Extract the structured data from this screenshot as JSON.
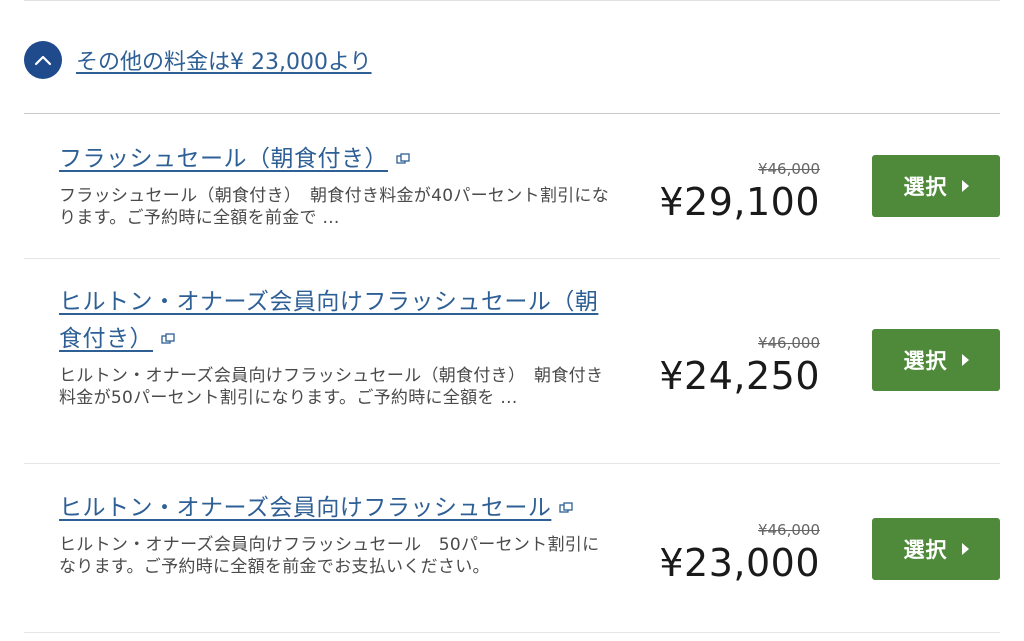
{
  "other_rates": {
    "toggle_label": "その他の料金は¥ 23,000より",
    "toggle_icon": "chevron-up-icon",
    "accent_color": "#1f4a8c"
  },
  "rates": [
    {
      "title": "フラッシュセール（朝食付き）",
      "description": "フラッシュセール（朝食付き）　朝食付き料金が40パーセント割引になります。ご予約時に全額を前金で ...",
      "original_price": "¥46,000",
      "price": "¥29,100",
      "button_label": "選択"
    },
    {
      "title": "ヒルトン・オナーズ会員向けフラッシュセール（朝食付き）",
      "description": "ヒルトン・オナーズ会員向けフラッシュセール（朝食付き）　朝食付き料金が50パーセント割引になります。ご予約時に全額を ...",
      "original_price": "¥46,000",
      "price": "¥24,250",
      "button_label": "選択"
    },
    {
      "title": "ヒルトン・オナーズ会員向けフラッシュセール",
      "description": "ヒルトン・オナーズ会員向けフラッシュセール　50パーセント割引になります。ご予約時に全額を前金でお支払いください。",
      "original_price": "¥46,000",
      "price": "¥23,000",
      "button_label": "選択"
    }
  ],
  "colors": {
    "link": "#2e5f95",
    "button": "#4e8a3a",
    "price": "#1a1a1a"
  }
}
